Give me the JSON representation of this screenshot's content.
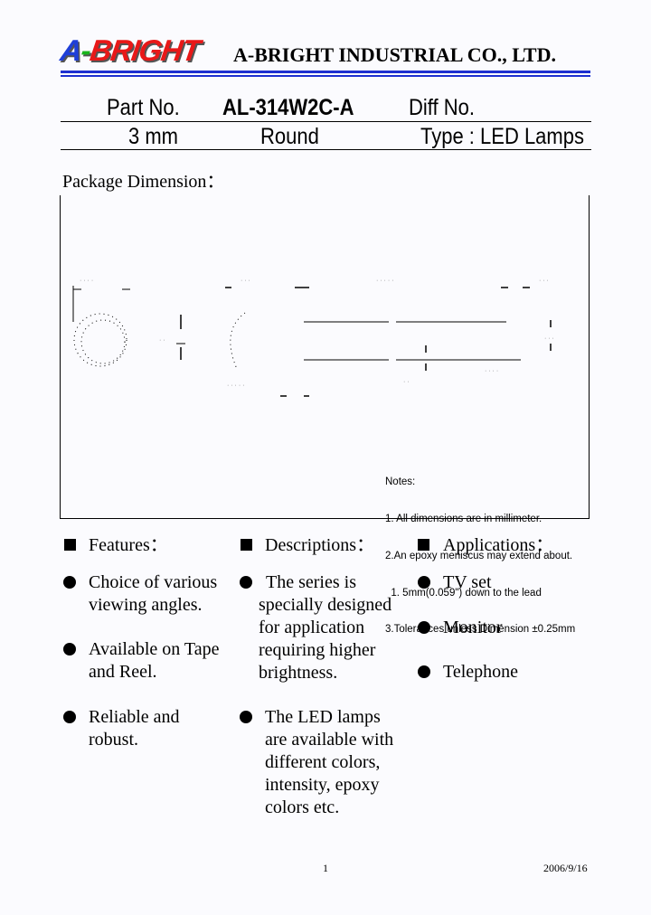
{
  "header": {
    "logo": {
      "part1": "A",
      "part2": "-",
      "part3": "BRIGHT"
    },
    "company_name": "A-BRIGHT INDUSTRIAL CO., LTD.",
    "colors": {
      "logo_blue": "#1f3fd8",
      "logo_green": "#18b41b",
      "logo_red": "#e81818",
      "rule_blue": "#1c2fd0"
    }
  },
  "part_info": {
    "part_no_label": "Part No.",
    "part_no_value": "AL-314W2C-A",
    "diff_no_label": "Diff No.",
    "size": "3 mm",
    "shape": "Round",
    "type": "Type : LED Lamps"
  },
  "package": {
    "title": "Package Dimension：",
    "notes": [
      "Notes:",
      "1. All dimensions are in millimeter.",
      "2.An epoxy meniscus may extend about.",
      "  1. 5mm(0.059\") down to the lead",
      "3.Tolerances unless Dimension ±0.25mm"
    ]
  },
  "features": {
    "heading": "Features：",
    "items": [
      [
        "Choice of various",
        "viewing angles."
      ],
      [
        "Available on Tape",
        "and Reel."
      ],
      [
        "Reliable and",
        "robust."
      ]
    ]
  },
  "descriptions": {
    "heading": "Descriptions：",
    "items": [
      [
        "The series is",
        "specially designed",
        "for application",
        "requiring higher",
        "brightness."
      ],
      [
        "The LED lamps",
        "are available with",
        "different colors,",
        "intensity, epoxy",
        "colors etc."
      ]
    ]
  },
  "applications": {
    "heading": "Applications：",
    "items": [
      "TV set",
      "Monitor",
      "Telephone"
    ]
  },
  "footer": {
    "page_number": "1",
    "date": "2006/9/16"
  }
}
